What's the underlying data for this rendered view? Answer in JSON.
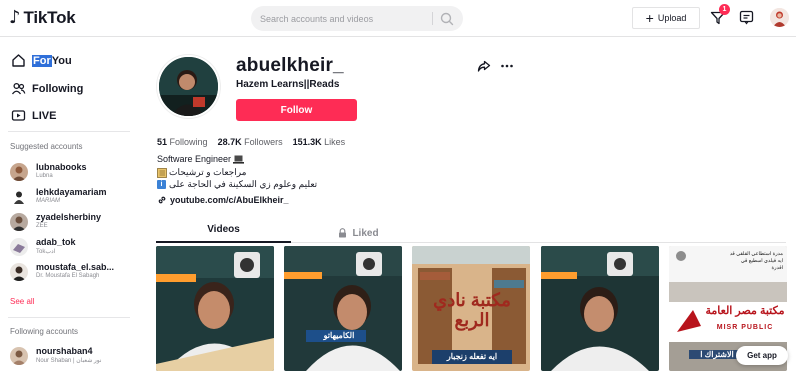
{
  "header": {
    "logo_text": "TikTok",
    "search_placeholder": "Search accounts and videos",
    "upload_label": "Upload",
    "inbox_count": "1"
  },
  "sidebar": {
    "nav": [
      {
        "label_sel": "For",
        "label_rest": "You",
        "icon": "home-icon"
      },
      {
        "label": "Following",
        "icon": "people-icon"
      },
      {
        "label": "LIVE",
        "icon": "live-icon"
      }
    ],
    "suggested_heading": "Suggested accounts",
    "suggested": [
      {
        "username": "lubnabooks",
        "nickname": "Lubna"
      },
      {
        "username": "lehkdayamariam",
        "nickname": "MARIAM"
      },
      {
        "username": "zyadelsherbiny",
        "nickname": "ZEE"
      },
      {
        "username": "adab_tok",
        "nickname": "Tokادب"
      },
      {
        "username": "moustafa_el.sab...",
        "nickname": "Dr. Moustafa El Sabagh"
      }
    ],
    "see_all": "See all",
    "following_heading": "Following accounts",
    "following": [
      {
        "username": "nourshaban4",
        "nickname": "Nour Shaban | نور شعبان"
      }
    ]
  },
  "profile": {
    "username": "abuelkheir_",
    "nickname": "Hazem Learns||Reads",
    "follow_label": "Follow",
    "stats": {
      "following_count": "51",
      "following_label": "Following",
      "followers_count": "28.7K",
      "followers_label": "Followers",
      "likes_count": "151.3K",
      "likes_label": "Likes"
    },
    "bio": {
      "line1": "Software Engineer",
      "line2": "مراجعات و ترشيحات",
      "line3": "تعليم وعلوم زي السكينة في الحاجة على",
      "link": "youtube.com/c/AbuElkheir_"
    }
  },
  "tabs": {
    "videos": "Videos",
    "liked": "Liked"
  },
  "thumbnails": {
    "t2_caption": "الكاميهاتو",
    "t3_title": "مكتبة نادي الربع",
    "t3_caption": "ايه تفعله زنجبار",
    "t5_note_line1": "مدرة استطاعي القلقي قد",
    "t5_note_line2": "ايه فيلدي اسطيع قي",
    "t5_note_line3": "اقدرة",
    "t5_sign": "مكتبة مصر العامة",
    "t5_sign_en": "MISR PUBLIC",
    "t5_sub": "الاشتراك ا"
  },
  "get_app": "Get app",
  "colors": {
    "accent": "#fe2c55",
    "text": "#161823",
    "muted": "#8a8b91"
  }
}
